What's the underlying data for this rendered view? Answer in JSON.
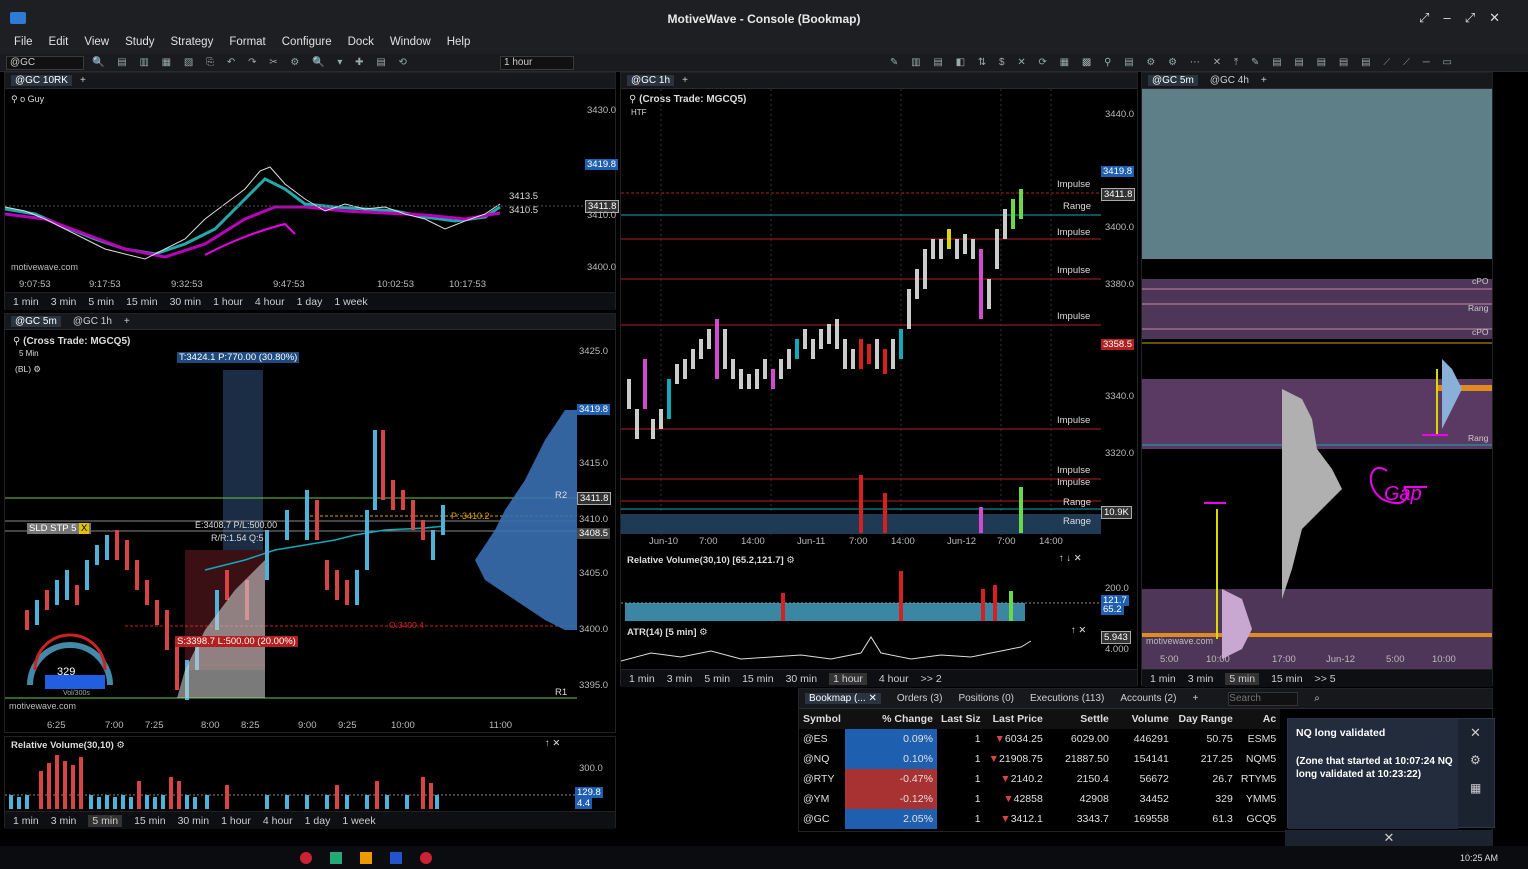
{
  "app": {
    "title": "MotiveWave - Console (Bookmap)"
  },
  "menu": [
    "File",
    "Edit",
    "View",
    "Study",
    "Strategy",
    "Format",
    "Configure",
    "Dock",
    "Window",
    "Help"
  ],
  "toolbar": {
    "symbol": "@GC",
    "timeframe": "1 hour"
  },
  "panel_topleft": {
    "tabs": [
      "@GC 10RK"
    ],
    "label": "o Guy",
    "prices": [
      "3430.0",
      "3419.8",
      "3413.5",
      "3411.8",
      "3410.5",
      "3410.0",
      "3400.0"
    ],
    "times": [
      "9:07:53",
      "9:17:53",
      "9:32:53",
      "9:47:53",
      "10:02:53",
      "10:17:53"
    ],
    "watermark": "motivewave.com"
  },
  "panel_midleft": {
    "tabs": [
      "@GC 5m",
      "@GC 1h"
    ],
    "title": "(Cross Trade: MGCQ5)",
    "subtitle": "5 Min",
    "bl": "(BL)",
    "target": "T:3424.1 P:770.00 (30.80%)",
    "entry": "E:3408.7 P/L:500.00",
    "rr": "R/R:1.54 Q:5",
    "stop": "S:3398.7 L:500.00 (20.00%)",
    "order": "SLD STP 5",
    "pline": "P: 3410.2",
    "oline": "O:3400.4",
    "gauge": "329",
    "gauge_sub": "Vol/300s",
    "prices": [
      "3425.0",
      "3419.8",
      "3415.0",
      "3411.8",
      "3410.0",
      "3408.5",
      "3405.0",
      "3400.0",
      "3395.0"
    ],
    "r_labels": [
      "R2",
      "R1"
    ],
    "times": [
      "6:25",
      "7:00",
      "7:25",
      "8:00",
      "8:25",
      "9:00",
      "9:25",
      "10:00",
      "11:00"
    ],
    "watermark": "motivewave.com"
  },
  "panel_botleft": {
    "label": "Relative Volume(30,10)",
    "prices": [
      "300.0",
      "129.8",
      "4.4"
    ]
  },
  "timeframes": [
    "1 min",
    "3 min",
    "5 min",
    "15 min",
    "30 min",
    "1 hour",
    "4 hour",
    "1 day",
    "1 week"
  ],
  "timeframes_left_selected": "5 min",
  "panel_center": {
    "tabs": [
      "@GC 1h"
    ],
    "title": "(Cross Trade: MGCQ5)",
    "sub": "HTF",
    "impulse_labels": [
      "Impulse",
      "Range",
      "Impulse",
      "Impulse",
      "Impulse",
      "Impulse",
      "Impulse",
      "Impulse",
      "Range",
      "Range"
    ],
    "prices": [
      "3440.0",
      "3419.8",
      "3411.8",
      "3400.0",
      "3380.0",
      "3358.5",
      "3340.0",
      "3320.0",
      "10.9K"
    ],
    "times": [
      "Jun-10",
      "7:00",
      "14:00",
      "Jun-11",
      "7:00",
      "14:00",
      "Jun-12",
      "7:00",
      "14:00"
    ],
    "rv_label": "Relative Volume(30,10) [65.2,121.7]",
    "rv_prices": [
      "200.0",
      "121.7",
      "65.2"
    ],
    "atr_label": "ATR(14) [5 min]",
    "atr_prices": [
      "5.943",
      "4.000"
    ],
    "timeframes": [
      "1 min",
      "3 min",
      "5 min",
      "15 min",
      "30 min",
      "1 hour",
      "4 hour",
      ">> 2"
    ],
    "selected": "1 hour"
  },
  "panel_right": {
    "tabs": [
      "@GC 5m",
      "@GC 4h"
    ],
    "labels": [
      "cPO",
      "Rang",
      "cPO",
      "Rang"
    ],
    "annotation": "Gap",
    "times": [
      "5:00",
      "10:00",
      "17:00",
      "Jun-12",
      "5:00",
      "10:00"
    ],
    "timeframes": [
      "1 min",
      "3 min",
      "5 min",
      "15 min",
      ">> 5"
    ],
    "selected": "5 min",
    "watermark": "motivewave.com"
  },
  "watchlist": {
    "tabs": [
      "Bookmap (...",
      "Orders (3)",
      "Positions (0)",
      "Executions (113)",
      "Accounts (2)"
    ],
    "search_placeholder": "Search",
    "headers": [
      "Symbol",
      "% Change",
      "Last Siz",
      "Last Price",
      "Settle",
      "Volume",
      "Day Range",
      "Ac"
    ],
    "rows": [
      {
        "symbol": "@ES",
        "change": "0.09%",
        "dir": "pos",
        "size": "1",
        "price": "6034.25",
        "settle": "6029.00",
        "volume": "446291",
        "range": "50.75",
        "contract": "ESM5"
      },
      {
        "symbol": "@NQ",
        "change": "0.10%",
        "dir": "pos",
        "size": "1",
        "price": "21908.75",
        "settle": "21887.50",
        "volume": "154141",
        "range": "217.25",
        "contract": "NQM5"
      },
      {
        "symbol": "@RTY",
        "change": "-0.47%",
        "dir": "neg",
        "size": "1",
        "price": "2140.2",
        "settle": "2150.4",
        "volume": "56672",
        "range": "26.7",
        "contract": "RTYM5"
      },
      {
        "symbol": "@YM",
        "change": "-0.12%",
        "dir": "neg",
        "size": "1",
        "price": "42858",
        "settle": "42908",
        "volume": "34452",
        "range": "329",
        "contract": "YMM5"
      },
      {
        "symbol": "@GC",
        "change": "2.05%",
        "dir": "pos",
        "size": "1",
        "price": "3412.1",
        "settle": "3343.7",
        "volume": "169558",
        "range": "61.3",
        "contract": "GCQ5"
      }
    ]
  },
  "notification": {
    "title": "NQ long validated",
    "body": "(Zone that started at 10:07:24 NQ long validated at 10:23:22)"
  },
  "clock": "10:25 AM",
  "colors": {
    "up": "#4fb3d9",
    "down": "#d64545",
    "accent": "#e0e",
    "bg": "#000000"
  }
}
